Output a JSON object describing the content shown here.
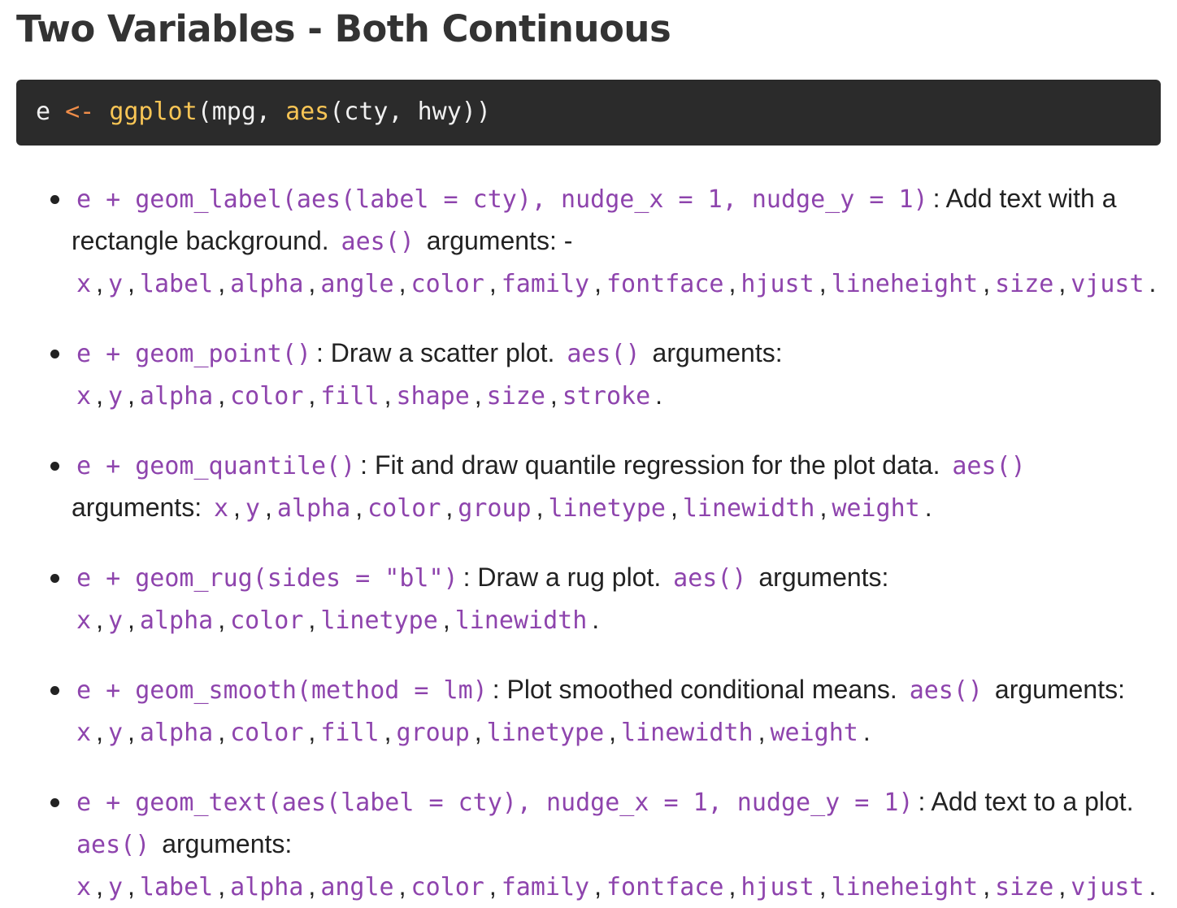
{
  "heading": "Two Variables - Both Continuous",
  "code": {
    "var": "e ",
    "assign": "<-",
    "fn1": "ggplot",
    "mid": "(mpg, ",
    "fn2": "aes",
    "end": "(cty, hwy))"
  },
  "items": [
    {
      "call": "e + geom_label(aes(label = cty), nudge_x = 1, nudge_y = 1)",
      "desc": ": Add text with a rectangle background. ",
      "aes": "aes()",
      "args_label": " arguments: - ",
      "args": [
        "x",
        "y",
        "label",
        "alpha",
        "angle",
        "color",
        "family",
        "fontface",
        "hjust",
        "lineheight",
        "size",
        "vjust"
      ]
    },
    {
      "call": "e + geom_point()",
      "desc": ": Draw a scatter plot. ",
      "aes": "aes()",
      "args_label": " arguments: ",
      "args": [
        "x",
        "y",
        "alpha",
        "color",
        "fill",
        "shape",
        "size",
        "stroke"
      ]
    },
    {
      "call": "e + geom_quantile()",
      "desc": ": Fit and draw quantile regression for the plot data. ",
      "aes": "aes()",
      "args_label": " arguments: ",
      "args": [
        "x",
        "y",
        "alpha",
        "color",
        "group",
        "linetype",
        "linewidth",
        "weight"
      ]
    },
    {
      "call": "e + geom_rug(sides = \"bl\")",
      "desc": ": Draw a rug plot. ",
      "aes": "aes()",
      "args_label": " arguments: ",
      "args": [
        "x",
        "y",
        "alpha",
        "color",
        "linetype",
        "linewidth"
      ]
    },
    {
      "call": "e + geom_smooth(method = lm)",
      "desc": ": Plot smoothed conditional means. ",
      "aes": "aes()",
      "args_label": " arguments: ",
      "args": [
        "x",
        "y",
        "alpha",
        "color",
        "fill",
        "group",
        "linetype",
        "linewidth",
        "weight"
      ]
    },
    {
      "call": "e + geom_text(aes(label = cty), nudge_x = 1, nudge_y = 1)",
      "desc": ": Add text to a plot. ",
      "aes": "aes()",
      "args_label": " arguments: ",
      "args": [
        "x",
        "y",
        "label",
        "alpha",
        "angle",
        "color",
        "family",
        "fontface",
        "hjust",
        "lineheight",
        "size",
        "vjust"
      ]
    }
  ]
}
